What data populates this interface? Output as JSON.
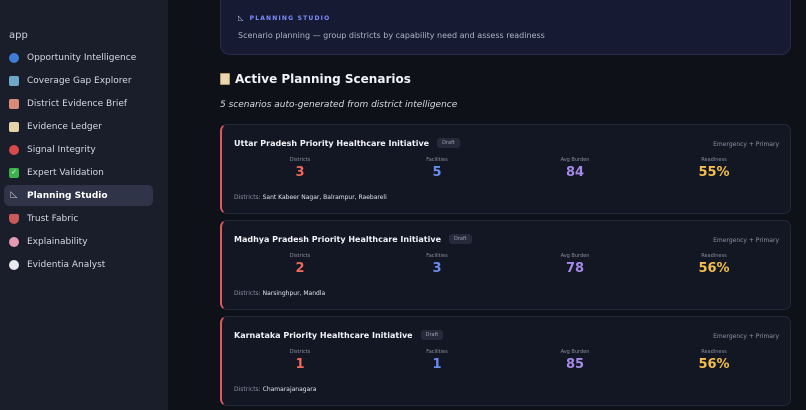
{
  "sidebar": {
    "app_name": "app",
    "items": [
      {
        "label": "Opportunity Intelligence",
        "icon": "globe-icon"
      },
      {
        "label": "Coverage Gap Explorer",
        "icon": "map-icon"
      },
      {
        "label": "District Evidence Brief",
        "icon": "school-icon"
      },
      {
        "label": "Evidence Ledger",
        "icon": "clipboard-icon"
      },
      {
        "label": "Signal Integrity",
        "icon": "dart-icon"
      },
      {
        "label": "Expert Validation",
        "icon": "checkmark-icon"
      },
      {
        "label": "Planning Studio",
        "icon": "ruler-icon",
        "active": true
      },
      {
        "label": "Trust Fabric",
        "icon": "shield-icon"
      },
      {
        "label": "Explainability",
        "icon": "brain-icon"
      },
      {
        "label": "Evidentia Analyst",
        "icon": "speech-bubble-icon"
      }
    ]
  },
  "banner": {
    "tag": "PLANNING STUDIO",
    "description": "Scenario planning — group districts by capability need and assess readiness"
  },
  "section": {
    "title": "Active Planning Scenarios",
    "subtitle": "5 scenarios auto-generated from district intelligence"
  },
  "labels": {
    "districts": "Districts",
    "facilities": "Facilities",
    "avg_burden": "Avg Burden",
    "readiness": "Readiness",
    "districts_prefix": "Districts:"
  },
  "scenarios": [
    {
      "title": "Uttar Pradesh Priority Healthcare Initiative",
      "status": "Draft",
      "tag": "Emergency + Primary",
      "districts": "3",
      "facilities": "5",
      "avg_burden": "84",
      "readiness": "55%",
      "district_list": "Sant Kabeer Nagar, Balrampur, Raebareli"
    },
    {
      "title": "Madhya Pradesh Priority Healthcare Initiative",
      "status": "Draft",
      "tag": "Emergency + Primary",
      "districts": "2",
      "facilities": "3",
      "avg_burden": "78",
      "readiness": "56%",
      "district_list": "Narsinghpur, Mandla"
    },
    {
      "title": "Karnataka Priority Healthcare Initiative",
      "status": "Draft",
      "tag": "Emergency + Primary",
      "districts": "1",
      "facilities": "1",
      "avg_burden": "85",
      "readiness": "56%",
      "district_list": "Chamarajanagara"
    }
  ],
  "colors": {
    "card_accent": "#e0585e",
    "districts": "#f0675c",
    "facilities": "#6a8cf0",
    "avg_burden": "#a48ae6",
    "readiness": "#f3bf4a"
  }
}
